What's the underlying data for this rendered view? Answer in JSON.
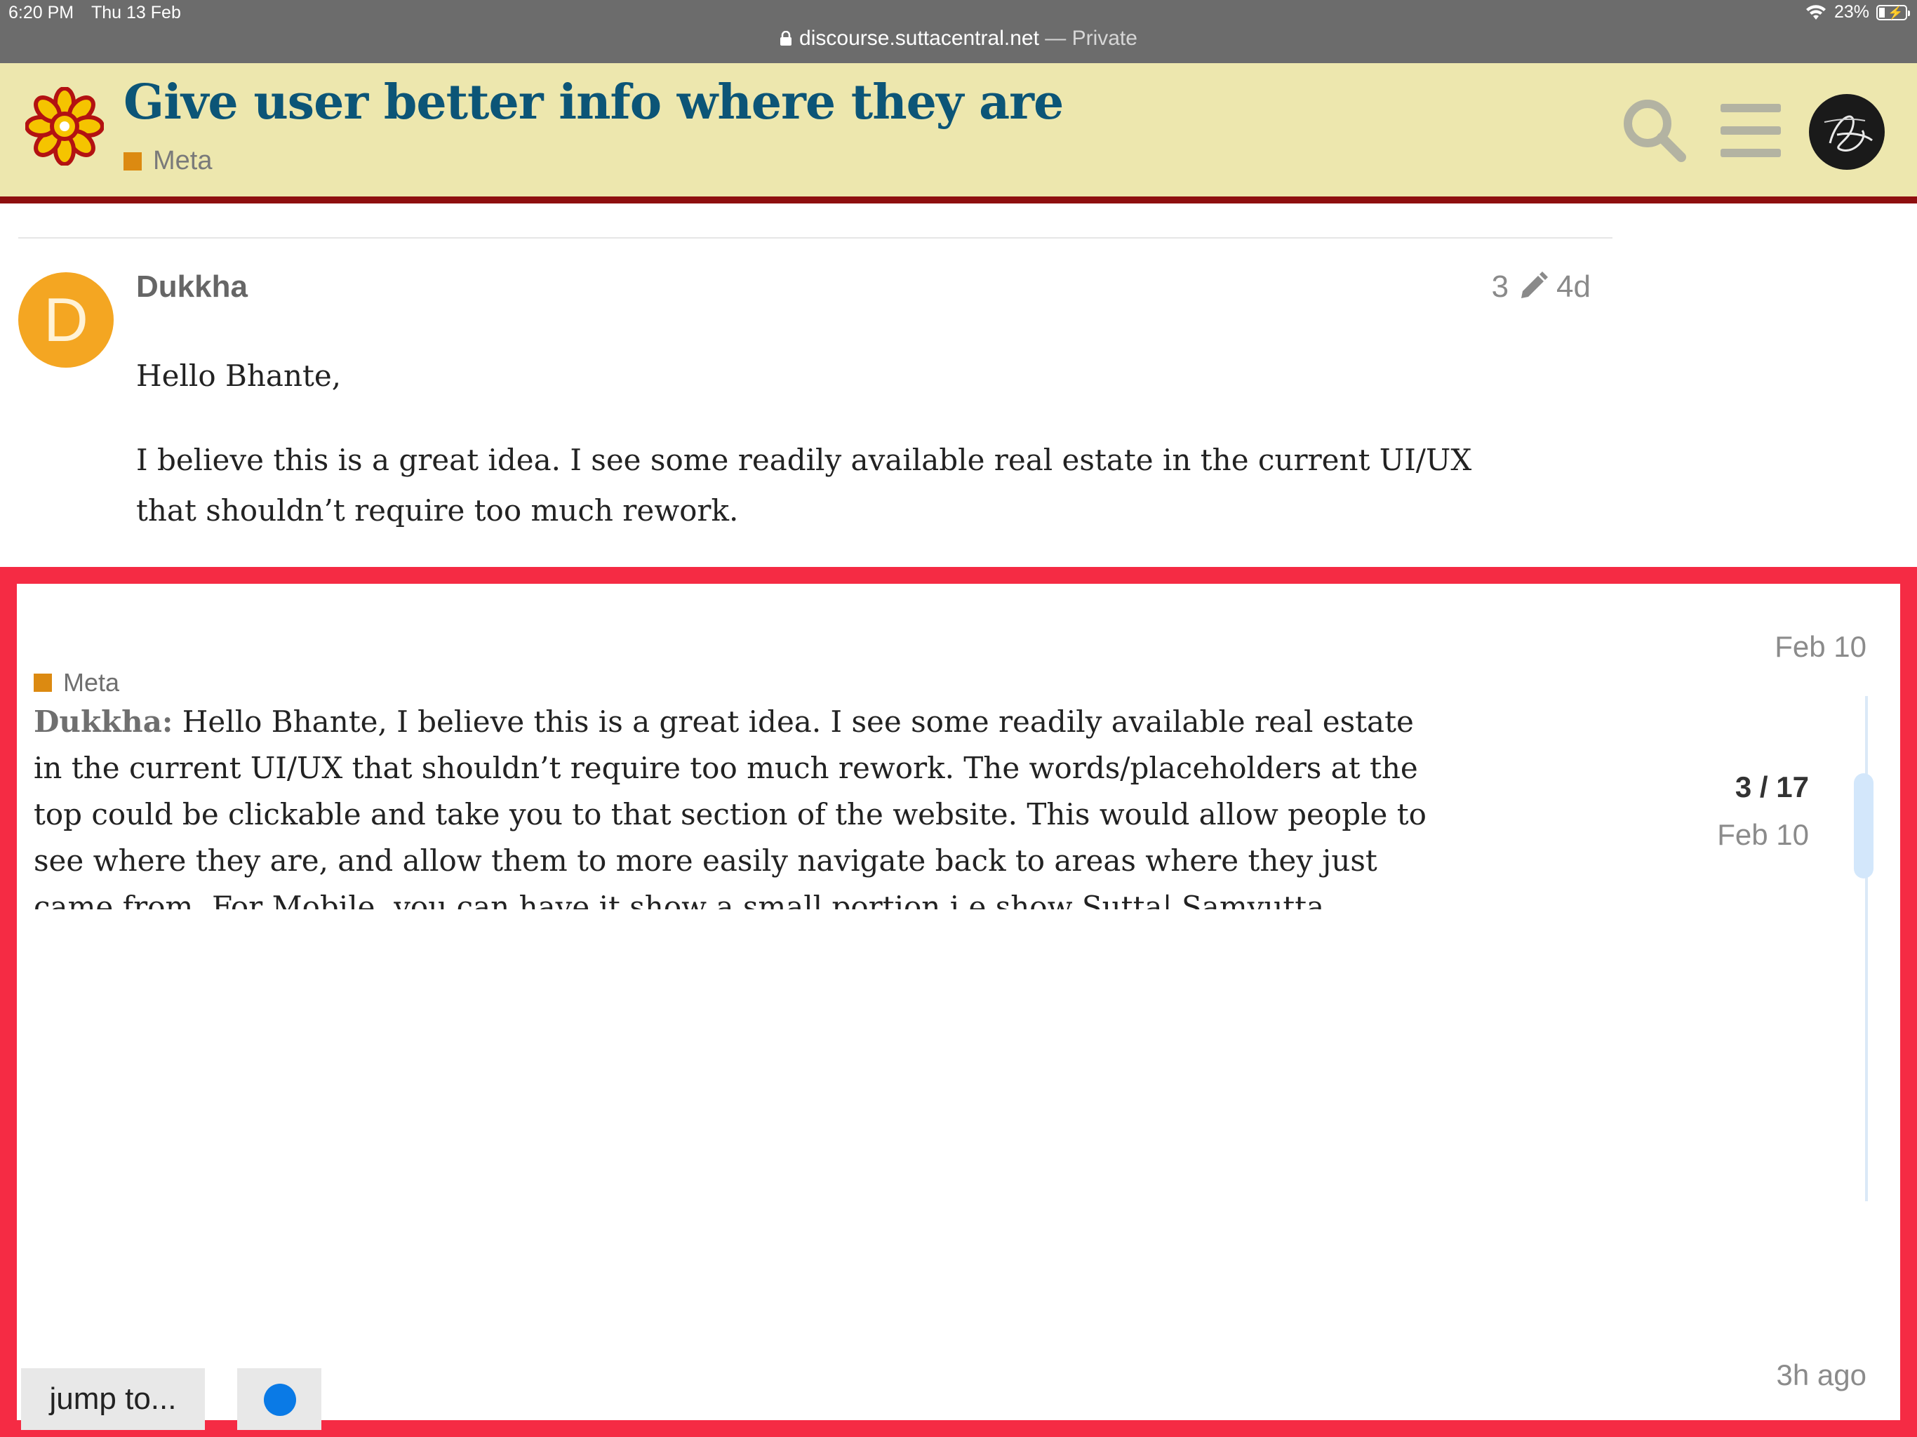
{
  "status_bar": {
    "time": "6:20 PM",
    "date": "Thu 13 Feb",
    "battery": "23%",
    "battery_level": 0.23,
    "url": "discourse.suttacentral.net",
    "url_suffix": " — Private"
  },
  "header": {
    "title": "Give user better info where they are",
    "category": "Meta",
    "category_color": "#dc8a11",
    "title_color": "#0c5577",
    "background": "#ede7ae",
    "accent": "#8e0f0f"
  },
  "post": {
    "avatar_letter": "D",
    "username": "Dukkha",
    "edit_count": "3",
    "age": "4d",
    "paragraphs": [
      "Hello Bhante,",
      "I believe this is a great idea. I see some readily available real estate in the current UI/UX that shouldn’t require too much rework."
    ]
  },
  "timeline": {
    "category": "Meta",
    "excerpt_author": "Dukkha:",
    "excerpt": "Hello Bhante, I believe this is a great idea. I see some readily available real estate in the current UI/UX that shouldn’t require too much rework. The words/placeholders at the top could be clickable and take you to that section of the website. This would allow people to see where they are, and allow them to more easily navigate back to areas where they just came from. For Mobile, you can have it show a small portion i.e show Sutta| Samyutta Nikaya -> and have a scroll bar with a -> or a <- on either side to let you move over to the hyperlinks that you can no longer see, since mobile shrinks it. The only reason I recommend not using the side bar option above(while it is cool and makes sense) is because you cant really see your",
    "start_date": "Feb 10",
    "position": "3 / 17",
    "position_date": "Feb 10",
    "end_label": "3h ago",
    "jump_label": "jump to...",
    "frame_color": "#f52b44"
  },
  "icons": {
    "logo": "dharma-flower-icon",
    "search": "search-icon",
    "menu": "hamburger-menu-icon",
    "user": "user-avatar",
    "edit": "pencil-icon",
    "unread": "blue-dot-icon"
  }
}
